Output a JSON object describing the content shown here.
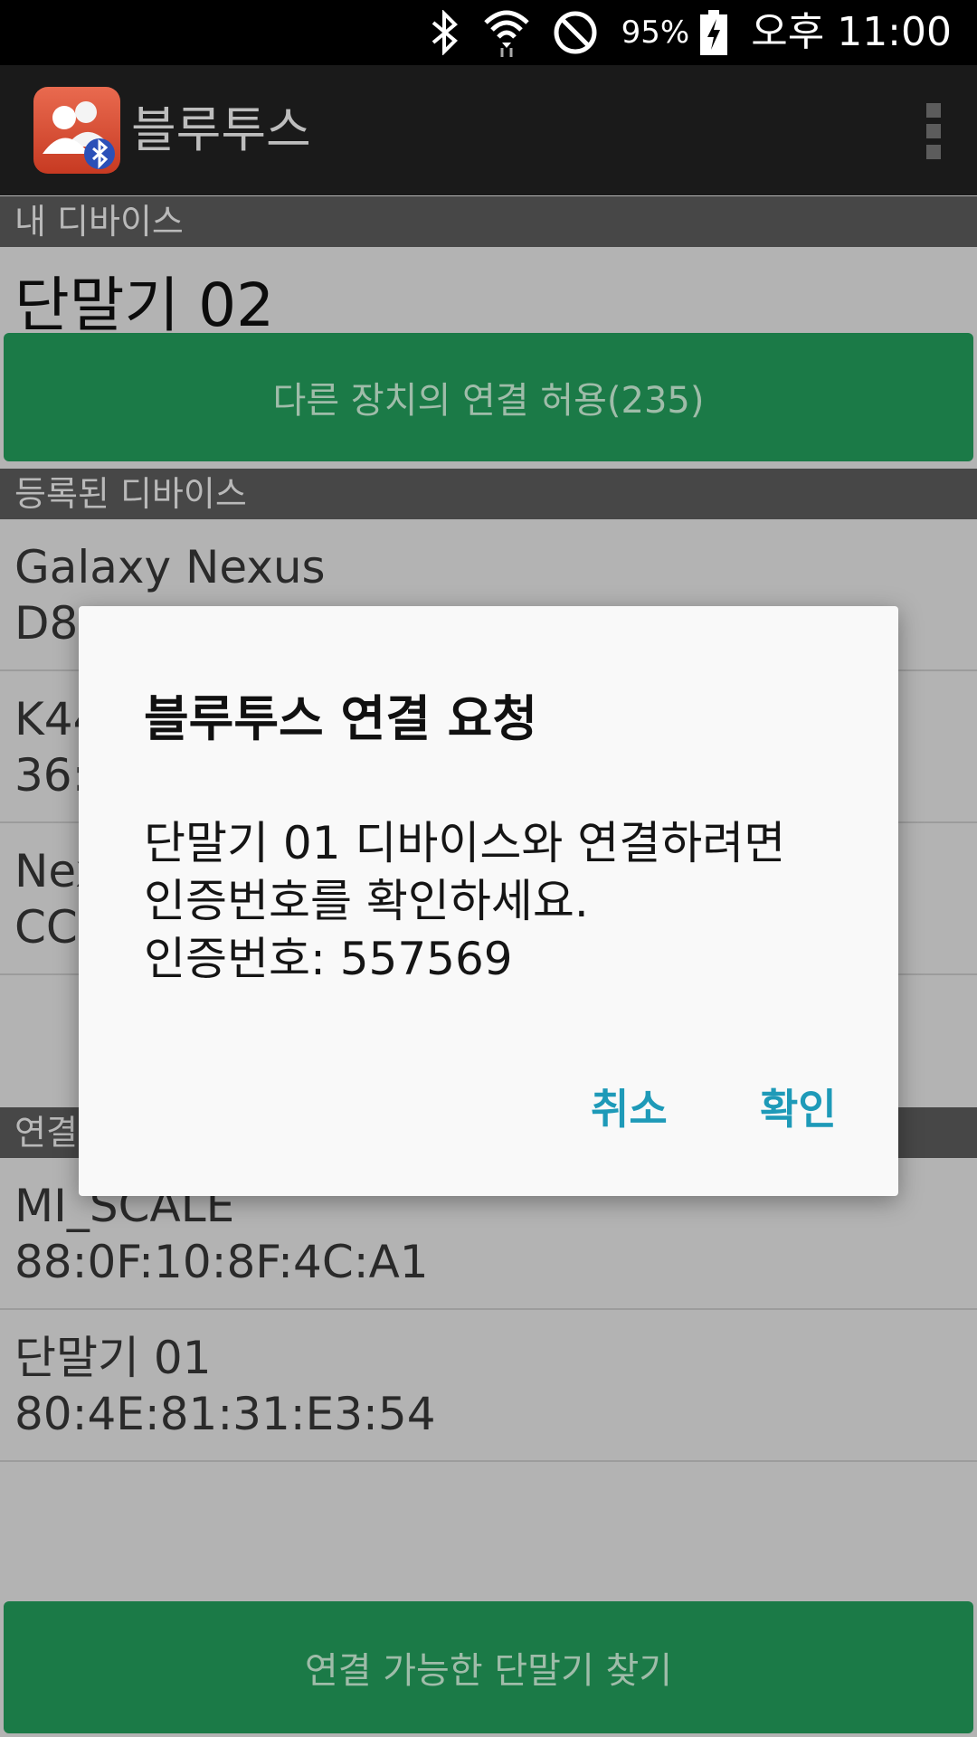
{
  "status_bar": {
    "battery": "95%",
    "time": "오후 11:00",
    "icons": [
      "bluetooth-icon",
      "wifi-icon",
      "do-not-disturb-icon",
      "battery-charging-icon"
    ]
  },
  "app_bar": {
    "title": "블루투스",
    "icon": "people-bluetooth-icon",
    "overflow_icon": "more-vert-icon"
  },
  "my_device": {
    "header": "내 디바이스",
    "name": "단말기 02",
    "discoverable_button": "다른 장치의 연결 허용(235)"
  },
  "registered": {
    "header": "등록된 디바이스",
    "items": [
      {
        "name": "Galaxy Nexus",
        "address": "D8:"
      },
      {
        "name": "K44",
        "address": "36:"
      },
      {
        "name": "Nex",
        "address": "CC"
      }
    ]
  },
  "connectable": {
    "header": "연결",
    "items": [
      {
        "name": "MI_SCALE",
        "address": "88:0F:10:8F:4C:A1"
      },
      {
        "name": "단말기 01",
        "address": "80:4E:81:31:E3:54"
      }
    ]
  },
  "find_button": "연결 가능한 단말기 찾기",
  "dialog": {
    "title": "블루투스 연결 요청",
    "message_lines": [
      "단말기 01 디바이스와 연결하려면",
      "인증번호를 확인하세요.",
      "인증번호: 557569"
    ],
    "cancel": "취소",
    "confirm": "확인"
  },
  "colors": {
    "primary_button": "#1b7a47",
    "dialog_button_text": "#1e9ab8",
    "section_header_bg": "#474747"
  }
}
